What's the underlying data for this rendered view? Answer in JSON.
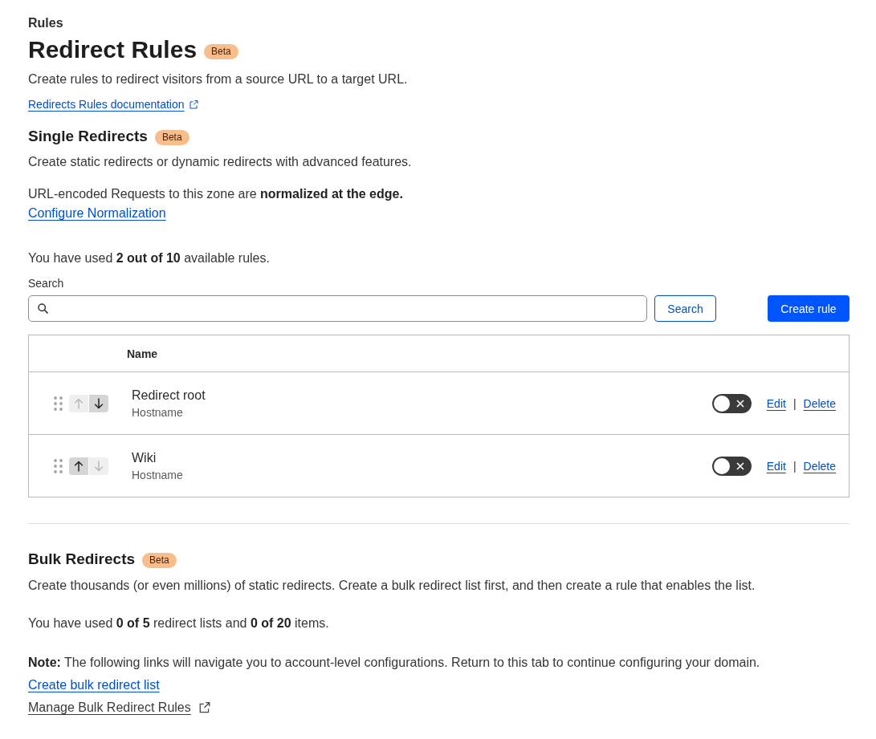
{
  "breadcrumb": "Rules",
  "header": {
    "title": "Redirect Rules",
    "badge": "Beta",
    "description": "Create rules to redirect visitors from a source URL to a target URL.",
    "doc_link": {
      "label": "Redirects Rules documentation",
      "external": true
    }
  },
  "single_redirects": {
    "title": "Single Redirects",
    "badge": "Beta",
    "description": "Create static redirects or dynamic redirects with advanced features.",
    "normalization_notice": "URL-encoded Requests to this zone are **normalized at the edge.**",
    "normalization_link": "Configure Normalization",
    "usage": "You have used **2 out of 10** available rules.",
    "search": {
      "label": "Search",
      "button": "Search"
    },
    "create_button": "Create rule",
    "table": {
      "columns": [
        "Name"
      ],
      "rows": [
        {
          "name": "Redirect root",
          "type": "Hostname",
          "enabled": false,
          "up_disabled": true,
          "down_disabled": false,
          "actions": [
            {
              "label": "Edit"
            },
            {
              "label": "Delete"
            }
          ],
          "separator": "|"
        },
        {
          "name": "Wiki",
          "type": "Hostname",
          "enabled": false,
          "up_disabled": false,
          "down_disabled": true,
          "actions": [
            {
              "label": "Edit"
            },
            {
              "label": "Delete"
            }
          ],
          "separator": "|"
        }
      ]
    }
  },
  "bulk_redirects": {
    "title": "Bulk Redirects",
    "badge": "Beta",
    "description": "Create thousands (or even millions) of static redirects. Create a bulk redirect list first, and then create a rule that enables the list.",
    "usage": "You have used **0 of 5** redirect lists and **0 of 20** items.",
    "note": "**Note:** The following links will navigate you to account-level configurations. Return to this tab to continue configuring your domain.",
    "links": [
      {
        "label": "Create bulk redirect list",
        "kind": "primary",
        "external": false
      },
      {
        "label": "Manage Bulk Redirect Rules",
        "kind": "muted",
        "external": true
      }
    ]
  }
}
